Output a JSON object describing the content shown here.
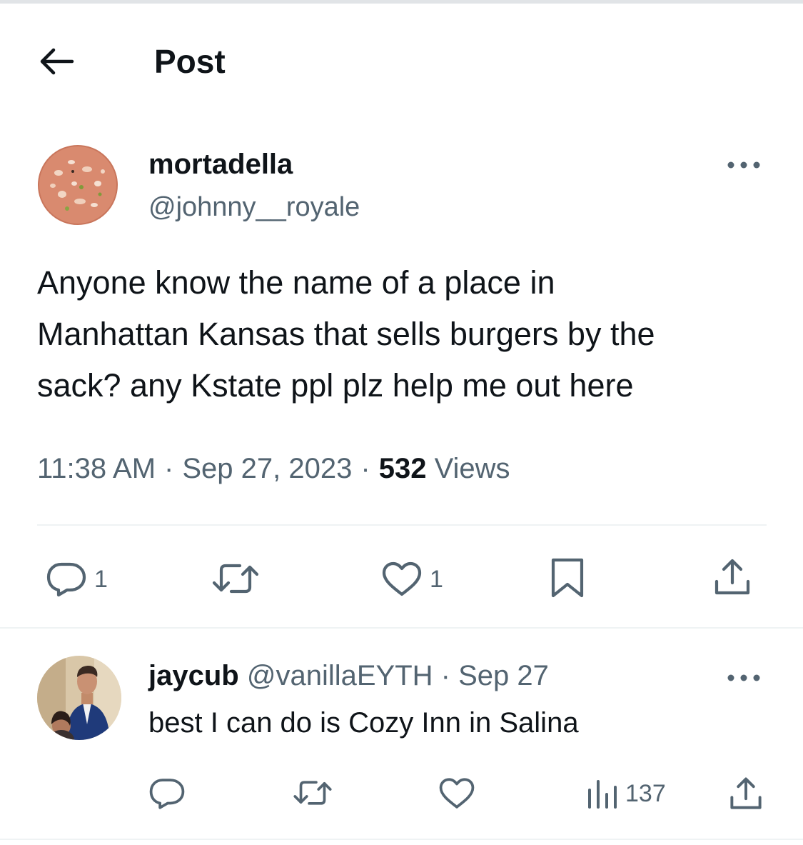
{
  "header": {
    "title": "Post",
    "back_icon": "arrow-left-icon"
  },
  "tweet": {
    "author": {
      "display_name": "mortadella",
      "handle": "@johnny__royale"
    },
    "text_lines": [
      "Anyone know the name of a place in",
      "Manhattan Kansas that sells burgers by the",
      "sack? any Kstate ppl plz help me out here"
    ],
    "time": "11:38 AM",
    "date": "Sep 27, 2023",
    "separator": "·",
    "views_count": "532",
    "views_label": "Views",
    "actions": {
      "reply_count": "1",
      "repost_count": "",
      "like_count": "1",
      "icons": [
        "reply-icon",
        "repost-icon",
        "like-icon",
        "bookmark-icon",
        "share-icon"
      ]
    }
  },
  "reply": {
    "author": {
      "display_name": "jaycub",
      "handle": "@vanillaEYTH"
    },
    "separator": "·",
    "date": "Sep 27",
    "text": "best I can do is Cozy Inn in Salina",
    "actions": {
      "views_count": "137",
      "icons": [
        "reply-icon",
        "repost-icon",
        "like-icon",
        "analytics-icon",
        "share-icon"
      ]
    }
  },
  "colors": {
    "text": "#0f1419",
    "secondary": "#536471",
    "divider": "#eff3f4",
    "background": "#ffffff"
  }
}
